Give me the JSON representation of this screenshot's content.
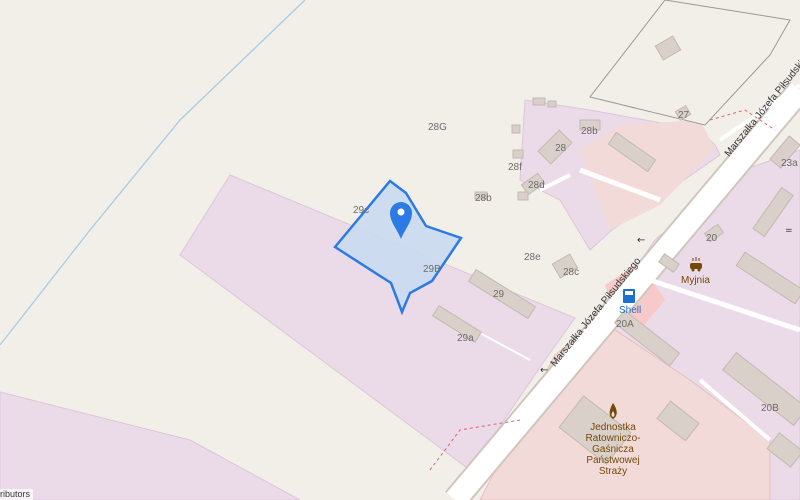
{
  "map": {
    "attribution": "ributors",
    "colors": {
      "background": "#f2efe9",
      "industrial": "#ebdbe8",
      "commercial": "#f2dad9",
      "building": "#d9d0c9",
      "road": "#ffffff",
      "selection_fill": "#c9daf0",
      "selection_stroke": "#2c7be5",
      "marker": "#2c7be5"
    },
    "address_labels": {
      "n28G": "28G",
      "n28b": "28b",
      "n28": "28",
      "n28f": "28f",
      "n28d": "28d",
      "n28b_lower": "28b",
      "n28e": "28e",
      "n28c": "28c",
      "n29c": "29c",
      "n29B": "29B",
      "n29": "29",
      "n29a": "29a",
      "n27": "27",
      "n23a": "23a",
      "n20": "20",
      "n20A": "20A",
      "n20B": "20B"
    },
    "streets": {
      "main_lower": "Marszałka Józefa Piłsudskiego",
      "main_upper": "Marszałka Józefa Piłsudski"
    },
    "pois": {
      "carwash": "Myjnia",
      "fuel": "Shell",
      "fire_station": [
        "Jednostka",
        "Ratowniczo-",
        "Gaśnicza",
        "Państwowej",
        "Straży"
      ]
    },
    "icons": {
      "marker": "map-pin-icon",
      "carwash": "car-wash-icon",
      "fuel": "fuel-pump-icon",
      "fire": "fire-station-icon"
    }
  }
}
